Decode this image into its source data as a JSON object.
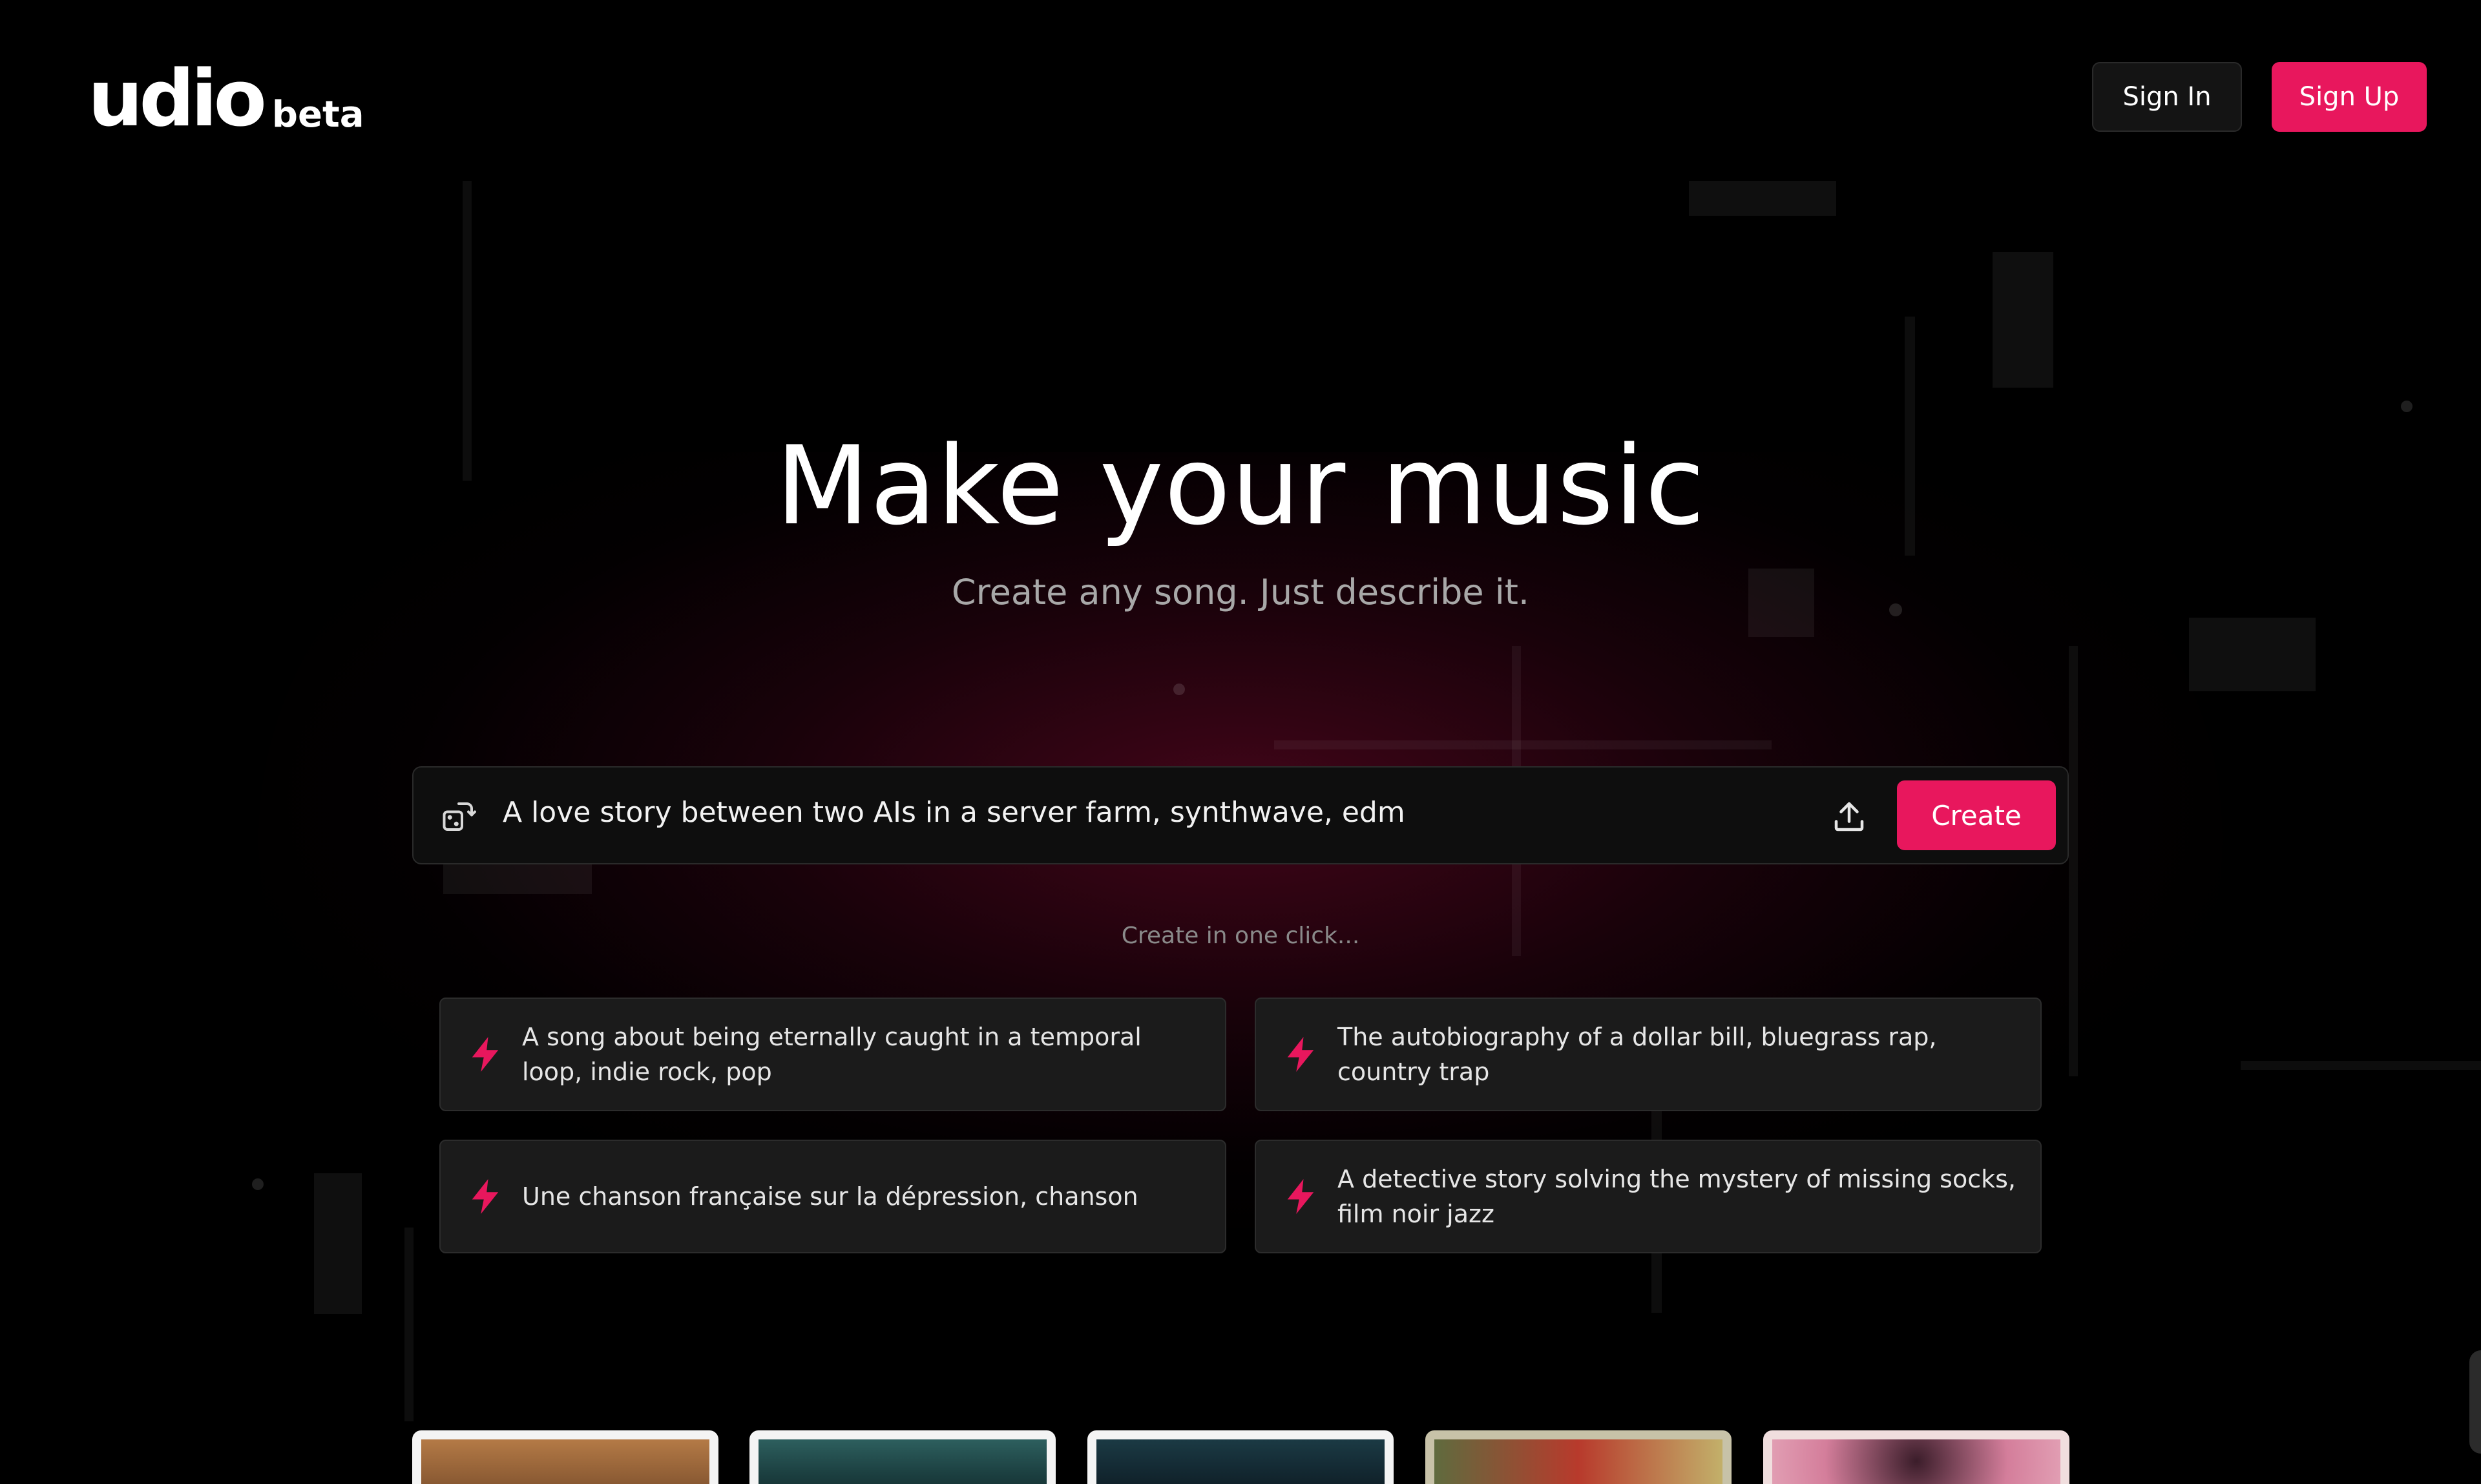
{
  "header": {
    "logo_word": "udio",
    "logo_suffix": "beta",
    "sign_in_label": "Sign In",
    "sign_up_label": "Sign Up"
  },
  "hero": {
    "title": "Make your music",
    "subtitle": "Create any song. Just describe it."
  },
  "prompt": {
    "value": "A love story between two AIs in a server farm, synthwave, edm",
    "create_label": "Create"
  },
  "one_click": {
    "label": "Create in one click...",
    "suggestions": [
      "A song about being eternally caught in a temporal loop, indie rock, pop",
      "The autobiography of a dollar bill, bluegrass rap, country trap",
      "Une chanson française sur la dépression, chanson",
      "A detective story solving the mystery of missing socks, film noir jazz"
    ]
  },
  "colors": {
    "accent": "#e8175d",
    "background": "#000000",
    "card": "#1b1b1b"
  },
  "icons": {
    "prompt": "dice-swap-icon",
    "upload": "upload-icon",
    "suggestion": "lightning-bolt-icon"
  }
}
